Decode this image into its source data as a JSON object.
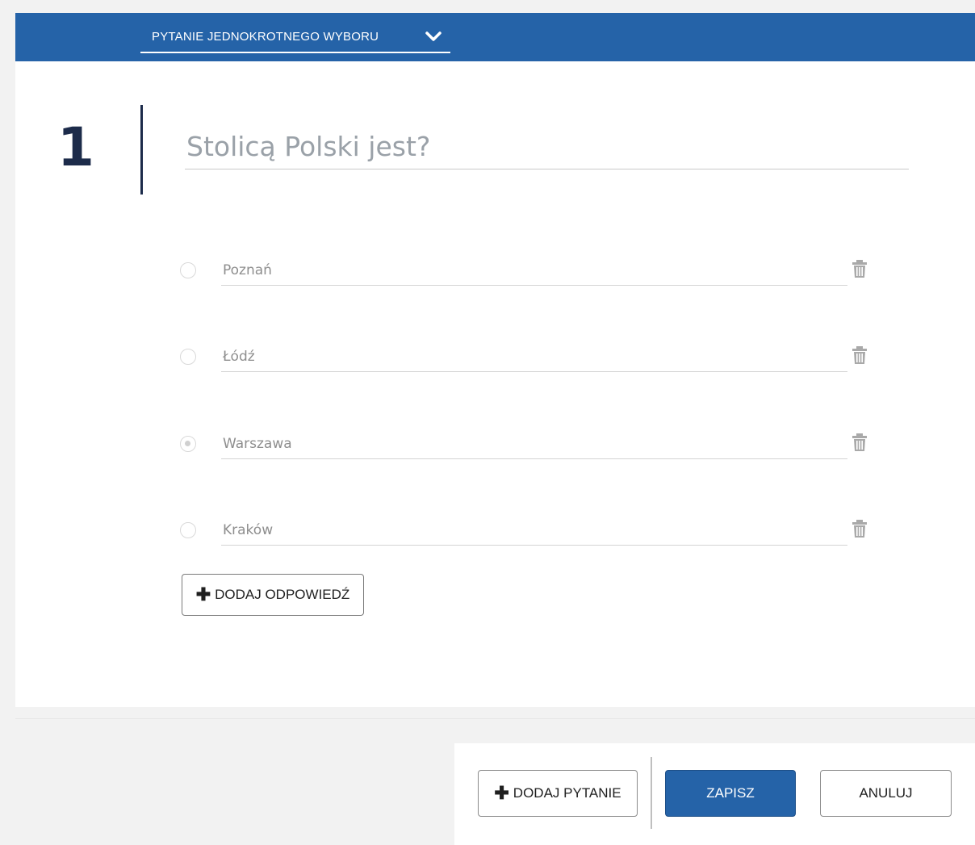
{
  "question_type": {
    "label": "PYTANIE JEDNOKROTNEGO WYBORU",
    "icon": "chevron-down-icon"
  },
  "question": {
    "number": "1",
    "text": "Stolicą Polski jest?"
  },
  "answers": [
    {
      "text": "Poznań",
      "selected": false,
      "delete_icon": "trash-icon"
    },
    {
      "text": "Łódź",
      "selected": false,
      "delete_icon": "trash-icon"
    },
    {
      "text": "Warszawa",
      "selected": true,
      "delete_icon": "trash-icon"
    },
    {
      "text": "Kraków",
      "selected": false,
      "delete_icon": "trash-icon"
    }
  ],
  "add_answer": {
    "icon": "plus-icon",
    "label": "DODAJ ODPOWIEDŹ"
  },
  "footer": {
    "add_question": {
      "icon": "plus-icon",
      "label": "DODAJ PYTANIE"
    },
    "save_label": "ZAPISZ",
    "cancel_label": "ANULUJ"
  },
  "colors": {
    "accent": "#2563a8",
    "heading": "#1c2b4a"
  }
}
